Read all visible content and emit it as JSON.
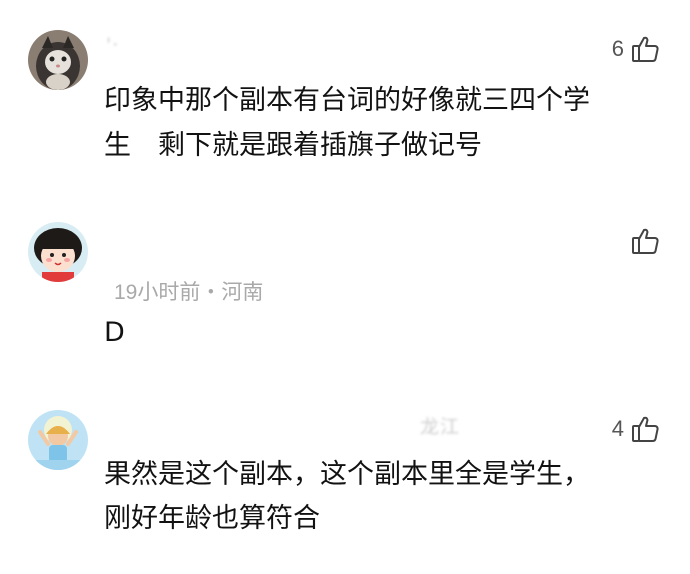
{
  "comments": [
    {
      "username": "'·",
      "likes": "6",
      "text_lines": [
        "印象中那个副本有台词的好像就三四个学",
        "生　剩下就是跟着插旗子做记号"
      ],
      "meta": ""
    },
    {
      "username": "",
      "likes": "",
      "text_lines": [
        "D"
      ],
      "meta": "19小时前・河南"
    },
    {
      "username": "龙江",
      "likes": "4",
      "text_lines": [
        "果然是这个副本，这个副本里全是学生，",
        "刚好年龄也算符合"
      ],
      "meta": ""
    }
  ],
  "icons": {
    "like": "thumbs-up-icon",
    "avatar1": "cat-avatar",
    "avatar2": "cartoon-girl-avatar",
    "avatar3": "beach-girl-avatar"
  },
  "colors": {
    "text": "#121212",
    "meta": "#a9a9a9",
    "like_count": "#555555"
  }
}
